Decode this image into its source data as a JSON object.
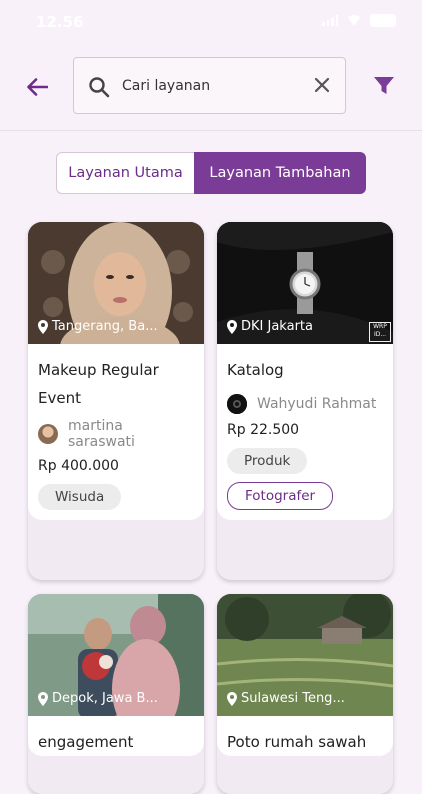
{
  "status": {
    "time": "12.56"
  },
  "search": {
    "placeholder": "Cari layanan"
  },
  "tabs": [
    {
      "label": "Layanan Utama",
      "active": false
    },
    {
      "label": "Layanan Tambahan",
      "active": true
    }
  ],
  "colors": {
    "primary": "#7b3c97",
    "background": "#f8f1f9"
  },
  "icons": {
    "back": "arrow-left-icon",
    "search": "magnifier-icon",
    "clear": "close-icon",
    "filter": "funnel-icon",
    "location": "pin-icon"
  },
  "cards": [
    {
      "location": "Tangerang, Ba...",
      "title_line1": "Makeup Regular",
      "title_line2": "Event",
      "provider": "martina saraswati",
      "price": "Rp 400.000",
      "tags": [
        "Wisuda"
      ]
    },
    {
      "location": "DKI Jakarta",
      "title_line1": "Katalog",
      "provider": "Wahyudi Rahmat",
      "price": "Rp 22.500",
      "tags": [
        "Produk",
        "Fotografer"
      ],
      "watermark": "WRP ID..."
    },
    {
      "location": "Depok, Jawa B...",
      "title_line1": "engagement"
    },
    {
      "location": "Sulawesi Teng...",
      "title_line1": "Poto rumah sawah"
    }
  ]
}
